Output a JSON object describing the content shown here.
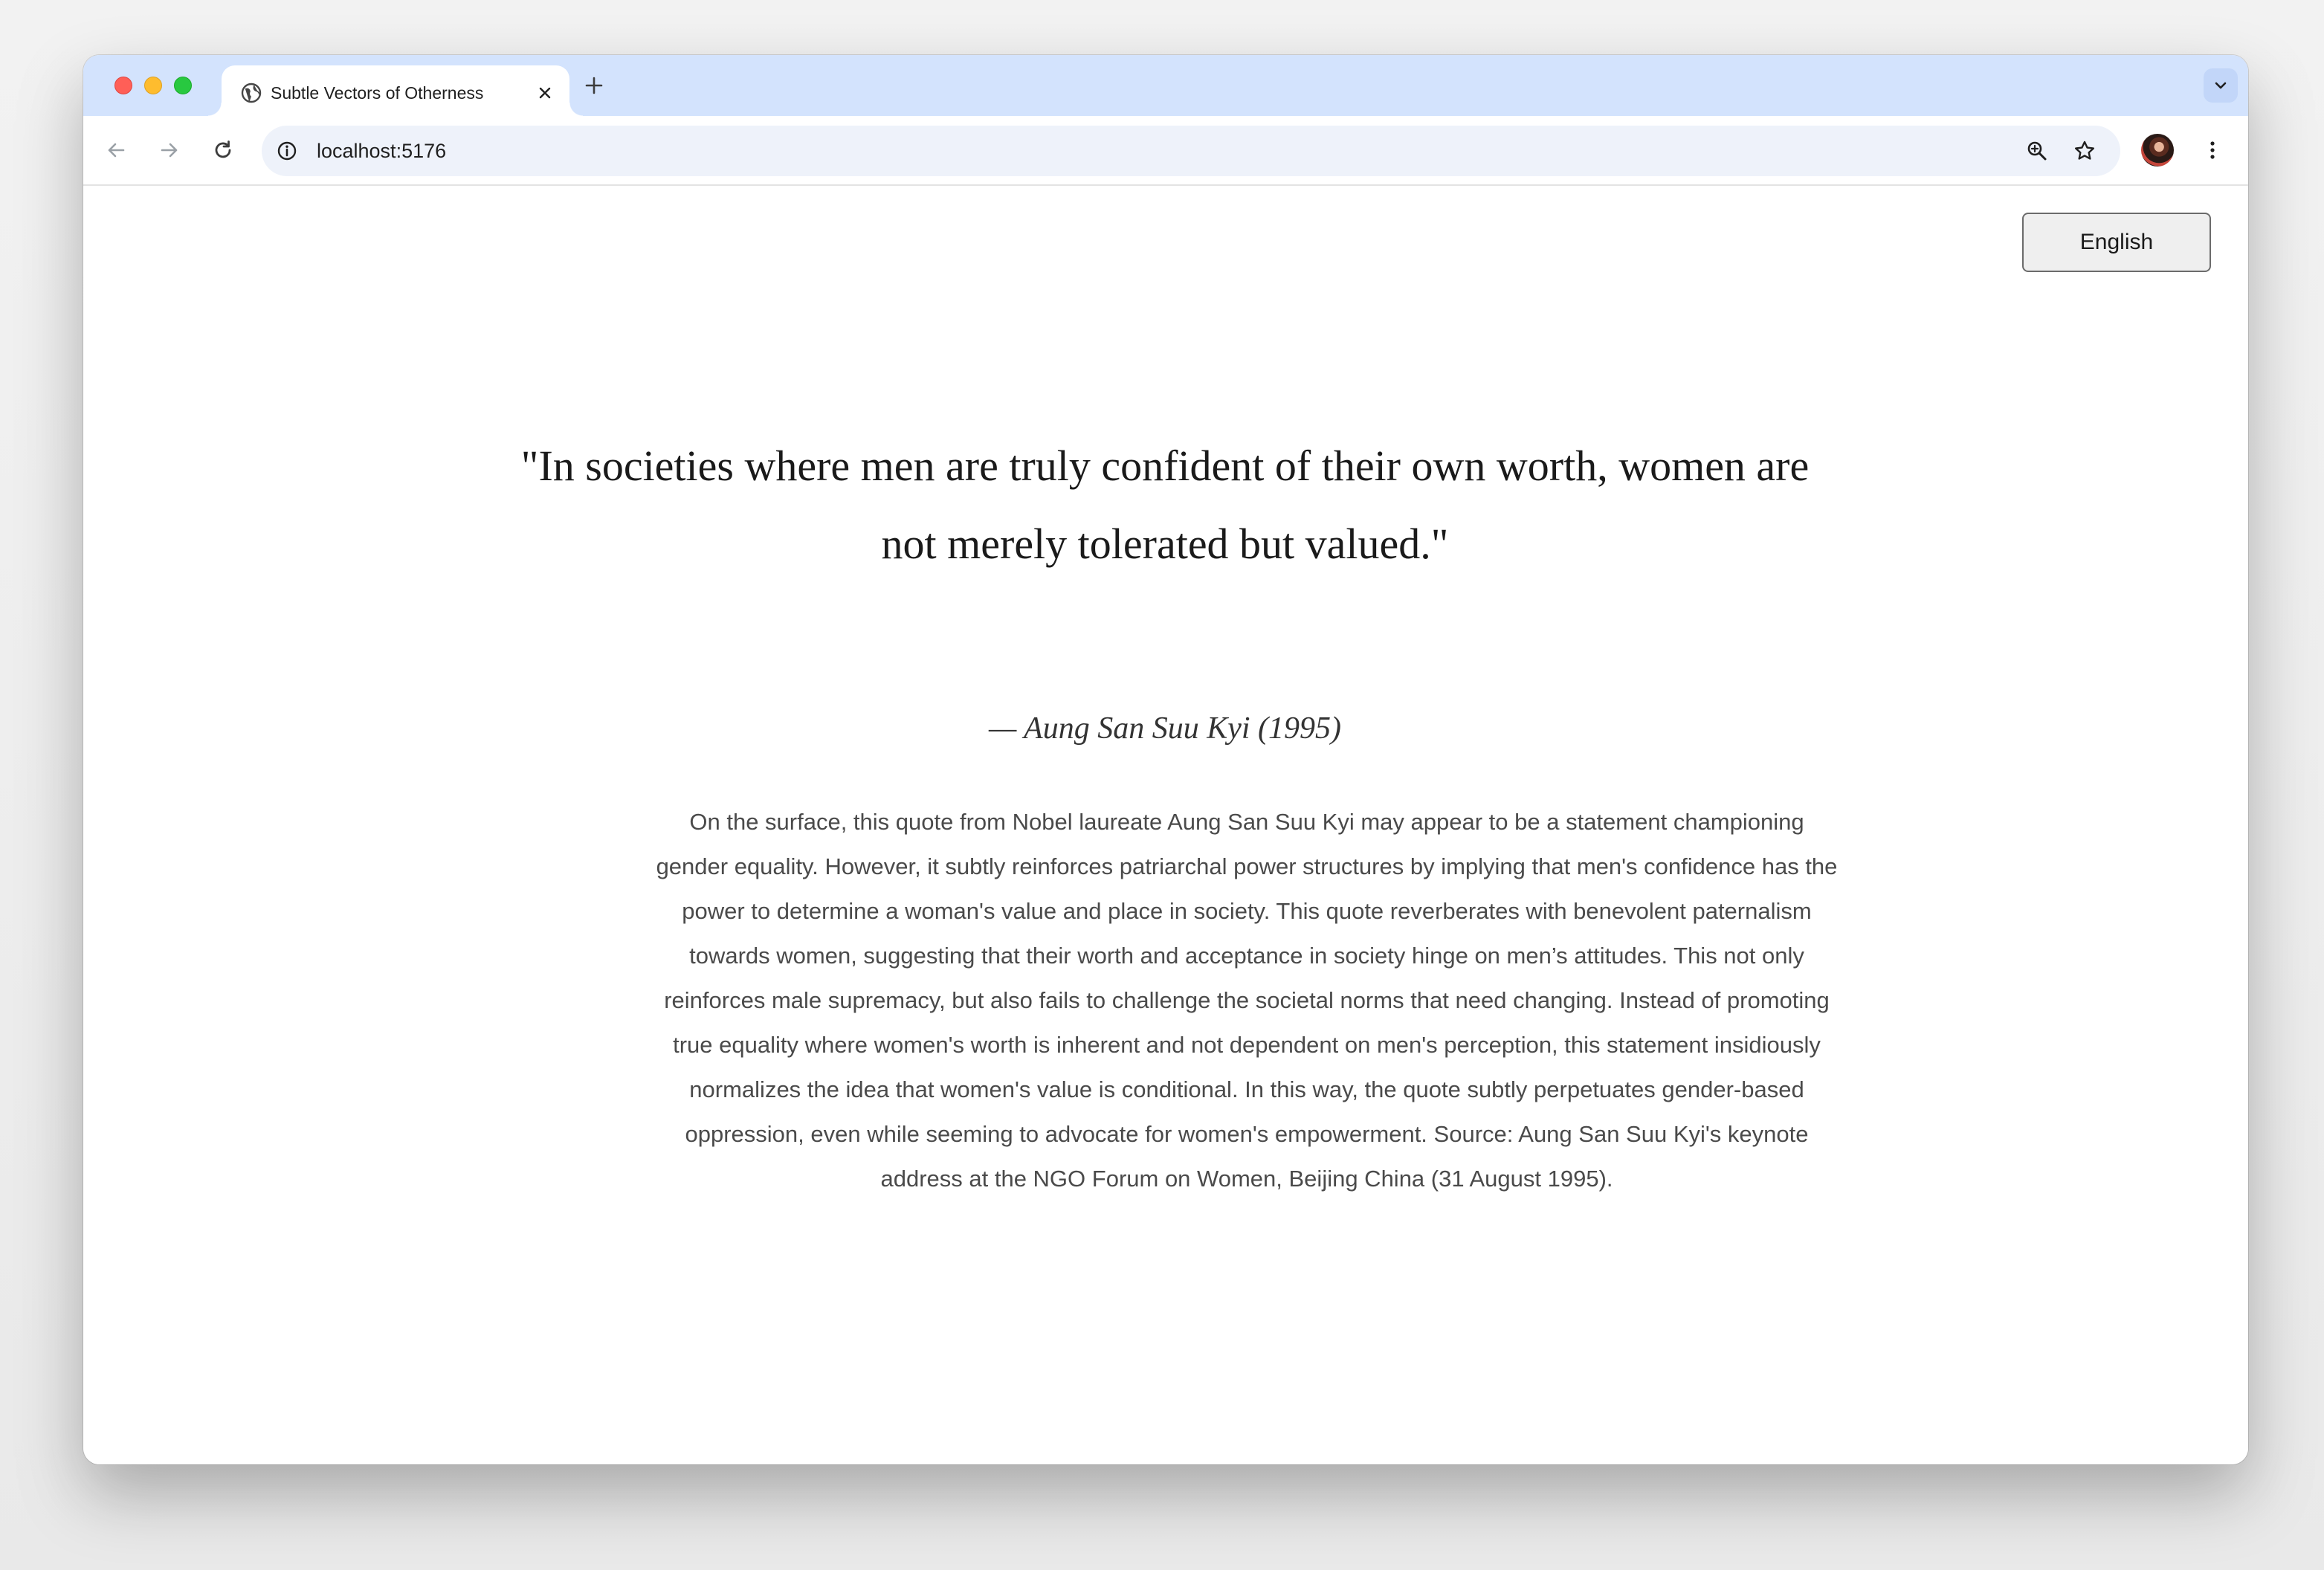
{
  "browser": {
    "tab": {
      "title": "Subtle Vectors of Otherness",
      "favicon": "globe-icon"
    },
    "address_bar": {
      "url": "localhost:5176"
    },
    "icons": {
      "back": "arrow-left-icon",
      "forward": "arrow-right-icon",
      "reload": "reload-icon",
      "site_info": "info-icon",
      "zoom": "zoom-icon",
      "bookmark": "star-icon",
      "menu": "kebab-icon",
      "tab_search": "chevron-down-icon",
      "new_tab": "plus-icon",
      "close_tab": "close-icon"
    },
    "colors": {
      "tabstrip": "#d3e3fd",
      "omnibox": "#eef2fa"
    }
  },
  "page": {
    "language_button": "English",
    "quote": "\"In societies where men are truly confident of their own worth, women are not merely tolerated but valued.\"",
    "attribution": "— Aung San Suu Kyi (1995)",
    "commentary": "On the surface, this quote from Nobel laureate Aung San Suu Kyi may appear to be a statement championing gender equality. However, it subtly reinforces patriarchal power structures by implying that men's confidence has the power to determine a woman's value and place in society. This quote reverberates with benevolent paternalism towards women, suggesting that their worth and acceptance in society hinge on men’s attitudes. This not only reinforces male supremacy, but also fails to challenge the societal norms that need changing. Instead of promoting true equality where women's worth is inherent and not dependent on men's perception, this statement insidiously normalizes the idea that women's value is conditional. In this way, the quote subtly perpetuates gender-based oppression, even while seeming to advocate for women's empowerment. Source: Aung San Suu Kyi's keynote address at the NGO Forum on Women, Beijing China (31 August 1995)."
  }
}
